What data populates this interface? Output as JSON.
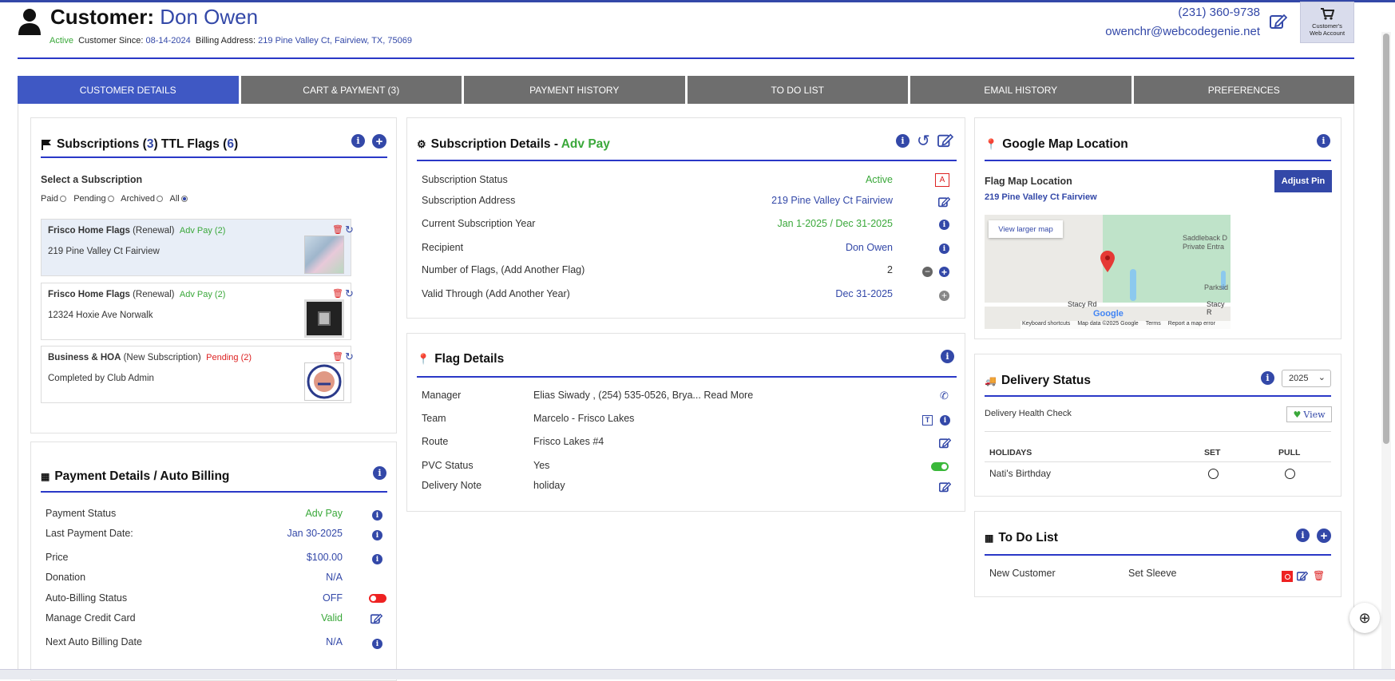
{
  "header": {
    "title_label": "Customer:",
    "customer_name": "Don Owen",
    "status": "Active",
    "since_label": "Customer Since:",
    "since_date": "08-14-2024",
    "billing_label": "Billing Address:",
    "billing_address": "219 Pine Valley Ct, Fairview, TX, 75069",
    "phone": "(231) 360-9738",
    "email": "owenchr@webcodegenie.net",
    "web_account_label": "Customer's Web Account"
  },
  "tabs": [
    {
      "label": "CUSTOMER DETAILS",
      "active": true
    },
    {
      "label": "CART & PAYMENT (3)"
    },
    {
      "label": "PAYMENT HISTORY"
    },
    {
      "label": "TO DO LIST"
    },
    {
      "label": "EMAIL HISTORY"
    },
    {
      "label": "PREFERENCES"
    }
  ],
  "subscriptions": {
    "title": "Subscriptions",
    "count": "3",
    "flags_label": "TTL Flags",
    "flags_count": "6",
    "select_label": "Select a Subscription",
    "filters": [
      "Paid",
      "Pending",
      "Archived",
      "All"
    ],
    "items": [
      {
        "name": "Frisco Home Flags",
        "type": "(Renewal)",
        "status": "Adv Pay (2)",
        "address": "219 Pine Valley Ct Fairview"
      },
      {
        "name": "Frisco Home Flags",
        "type": "(Renewal)",
        "status": "Adv Pay (2)",
        "address": "12324 Hoxie Ave Norwalk"
      },
      {
        "name": "Business & HOA",
        "type": "(New Subscription)",
        "status": "Pending (2)",
        "address": "Completed by Club Admin"
      }
    ]
  },
  "payment": {
    "title": "Payment Details / Auto Billing",
    "rows": [
      {
        "label": "Payment Status",
        "value": "Adv Pay"
      },
      {
        "label": "Last Payment Date:",
        "value": "Jan 30-2025"
      },
      {
        "label": "Price",
        "value": "$100.00"
      },
      {
        "label": "Donation",
        "value": "N/A"
      },
      {
        "label": "Auto-Billing Status",
        "value": "OFF"
      },
      {
        "label": "Manage Credit Card",
        "value": "Valid"
      },
      {
        "label": "Next Auto Billing Date",
        "value": "N/A"
      }
    ]
  },
  "subscription_details": {
    "title": "Subscription Details -",
    "title_status": "Adv Pay",
    "rows": [
      {
        "label": "Subscription Status",
        "value": "Active"
      },
      {
        "label": "Subscription Address",
        "value": "219 Pine Valley Ct Fairview"
      },
      {
        "label": "Current Subscription Year",
        "value": "Jan 1-2025 / Dec 31-2025"
      },
      {
        "label": "Recipient",
        "value": "Don Owen"
      },
      {
        "label": "Number of Flags, (Add Another Flag)",
        "value": "2"
      },
      {
        "label": "Valid Through (Add Another Year)",
        "value": "Dec 31-2025"
      }
    ],
    "status_badge": "A"
  },
  "flag_details": {
    "title": "Flag Details",
    "rows": [
      {
        "label": "Manager",
        "value": "Elias Siwady , (254) 535-0526, Brya...",
        "extra": "Read More"
      },
      {
        "label": "Team",
        "value": "Marcelo - Frisco Lakes"
      },
      {
        "label": "Route",
        "value": "Frisco Lakes #4"
      },
      {
        "label": "PVC Status",
        "value": "Yes"
      },
      {
        "label": "Delivery Note",
        "value": "holiday"
      }
    ]
  },
  "map": {
    "title": "Google Map Location",
    "subtitle": "Flag Map Location",
    "address": "219 Pine Valley Ct Fairview",
    "adjust_label": "Adjust Pin",
    "larger_map": "View larger map",
    "labels": [
      "Saddleback D",
      "Private Entra",
      "Parksid",
      "Stacy Rd",
      "Stacy R"
    ],
    "footer": [
      "Keyboard shortcuts",
      "Map data ©2025 Google",
      "Terms",
      "Report a map error"
    ],
    "google": "Google"
  },
  "delivery": {
    "title": "Delivery Status",
    "year": "2025",
    "health_label": "Delivery Health Check",
    "view_label": "View",
    "columns": [
      "HOLIDAYS",
      "SET",
      "PULL"
    ],
    "rows": [
      {
        "holiday": "Nati's Birthday"
      }
    ]
  },
  "todo": {
    "title": "To Do List",
    "rows": [
      {
        "item": "New Customer",
        "action": "Set Sleeve"
      }
    ]
  },
  "colors": {
    "brand": "#3348a8",
    "tab_active": "#3f58c4",
    "tab_inactive": "#6e6e6e",
    "green": "#3aa83a",
    "red": "#d22222"
  }
}
